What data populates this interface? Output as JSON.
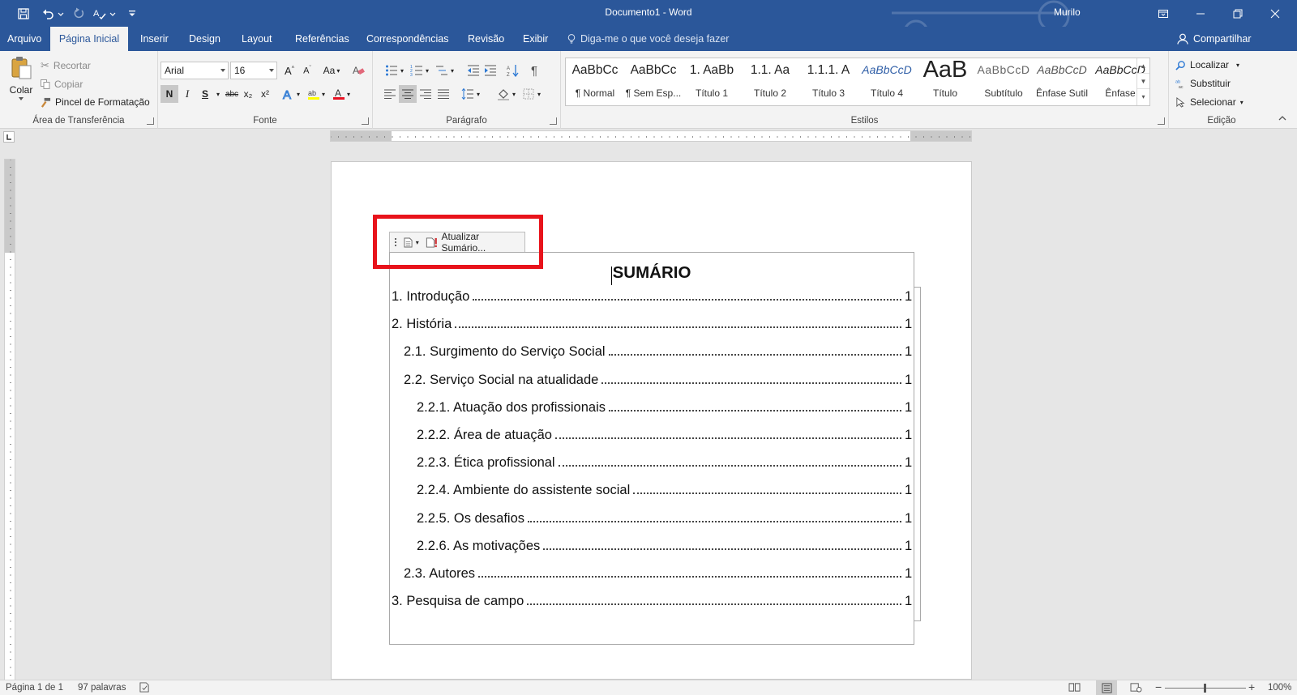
{
  "window": {
    "title": "Documento1  -  Word",
    "user": "Murilo"
  },
  "qat": {
    "save_icon": "save-icon",
    "undo_icon": "undo-icon",
    "redo_icon": "redo-icon",
    "spelling_icon": "spelling-icon"
  },
  "tabs": [
    {
      "label": "Arquivo",
      "active": false
    },
    {
      "label": "Página Inicial",
      "active": true
    },
    {
      "label": "Inserir",
      "active": false
    },
    {
      "label": "Design",
      "active": false
    },
    {
      "label": "Layout",
      "active": false
    },
    {
      "label": "Referências",
      "active": false
    },
    {
      "label": "Correspondências",
      "active": false
    },
    {
      "label": "Revisão",
      "active": false
    },
    {
      "label": "Exibir",
      "active": false
    }
  ],
  "tellme": {
    "label": "Diga-me o que você deseja fazer"
  },
  "share": {
    "label": "Compartilhar"
  },
  "clipboard": {
    "paste_label": "Colar",
    "cut_label": "Recortar",
    "copy_label": "Copiar",
    "format_painter_label": "Pincel de Formatação",
    "group_label": "Área de Transferência"
  },
  "font": {
    "family": "Arial",
    "size": "16",
    "group_label": "Fonte",
    "bold": "N",
    "italic": "I",
    "underline": "S",
    "strike": "abc",
    "sub": "x₂",
    "sup": "x²",
    "change_case": "Aa"
  },
  "paragraph": {
    "group_label": "Parágrafo"
  },
  "styles": {
    "group_label": "Estilos",
    "items": [
      {
        "preview": "AaBbCc",
        "name": "¶ Normal"
      },
      {
        "preview": "AaBbCc",
        "name": "¶ Sem Esp..."
      },
      {
        "preview": "1.  AaBb",
        "name": "Título 1"
      },
      {
        "preview": "1.1.  Aa",
        "name": "Título 2"
      },
      {
        "preview": "1.1.1.  A",
        "name": "Título 3"
      },
      {
        "preview": "AaBbCcD",
        "name": "Título 4"
      },
      {
        "preview": "AaB",
        "name": "Título"
      },
      {
        "preview": "AaBbCcD",
        "name": "Subtítulo"
      },
      {
        "preview": "AaBbCcD",
        "name": "Ênfase Sutil"
      },
      {
        "preview": "AaBbCcD",
        "name": "Ênfase"
      }
    ]
  },
  "editing": {
    "find_label": "Localizar",
    "replace_label": "Substituir",
    "select_label": "Selecionar",
    "group_label": "Edição"
  },
  "toc": {
    "update_label": "Atualizar Sumário...",
    "title": "SUMÁRIO",
    "entries": [
      {
        "text": "1. Introdução",
        "page": "1",
        "level": 1
      },
      {
        "text": "2. História",
        "page": "1",
        "level": 1
      },
      {
        "text": "2.1. Surgimento do Serviço Social",
        "page": "1",
        "level": 2
      },
      {
        "text": "2.2. Serviço Social na atualidade",
        "page": "1",
        "level": 2
      },
      {
        "text": "2.2.1. Atuação dos profissionais",
        "page": "1",
        "level": 3
      },
      {
        "text": "2.2.2. Área de atuação",
        "page": "1",
        "level": 3
      },
      {
        "text": "2.2.3. Ética profissional",
        "page": "1",
        "level": 3
      },
      {
        "text": "2.2.4. Ambiente do assistente social",
        "page": "1",
        "level": 3
      },
      {
        "text": "2.2.5. Os desafios",
        "page": "1",
        "level": 3
      },
      {
        "text": "2.2.6. As motivações",
        "page": "1",
        "level": 3
      },
      {
        "text": "2.3. Autores",
        "page": "1",
        "level": 2
      },
      {
        "text": "3. Pesquisa de campo",
        "page": "1",
        "level": 1
      }
    ]
  },
  "status": {
    "page": "Página 1 de 1",
    "words": "97 palavras",
    "zoom": "100%"
  },
  "colors": {
    "brand": "#2b579a",
    "highlight": "#e8131b"
  }
}
